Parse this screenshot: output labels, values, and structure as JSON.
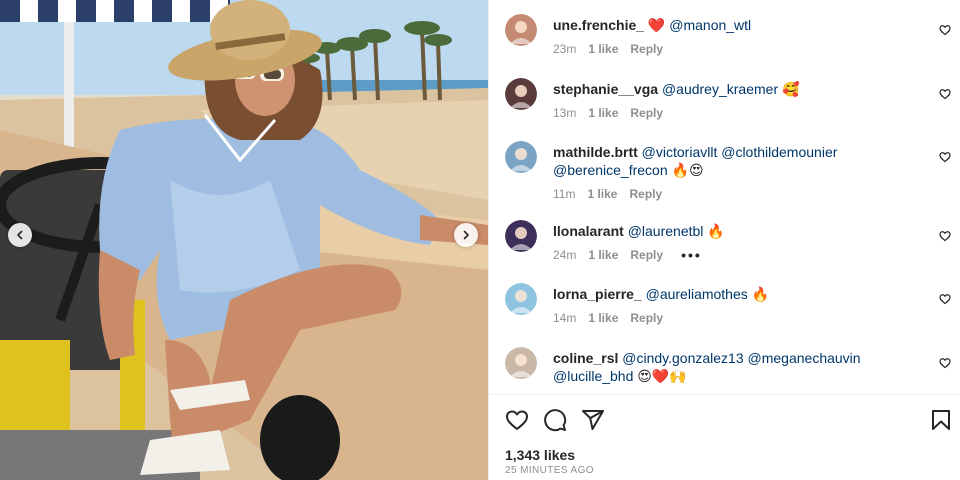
{
  "post": {
    "image_icon": "beach-photo",
    "nav": {
      "prev_icon": "chevron-left-icon",
      "next_icon": "chevron-right-icon"
    }
  },
  "comments": [
    {
      "username": "une.frenchie_",
      "text_parts": [
        {
          "t": "❤️ ",
          "m": false
        },
        {
          "t": "@manon_wtl",
          "m": true
        }
      ],
      "time": "23m",
      "likes": "1 like",
      "reply": "Reply",
      "avatar_color": "#c48a73"
    },
    {
      "username": "stephanie__vga",
      "text_parts": [
        {
          "t": "@audrey_kraemer",
          "m": true
        },
        {
          "t": " 🥰",
          "m": false
        }
      ],
      "time": "13m",
      "likes": "1 like",
      "reply": "Reply",
      "avatar_color": "#5a3a3a"
    },
    {
      "username": "mathilde.brtt",
      "text_parts": [
        {
          "t": "@victoriavllt",
          "m": true
        },
        {
          "t": " ",
          "m": false
        },
        {
          "t": "@clothildemounier",
          "m": true
        },
        {
          "t": " ",
          "m": false
        },
        {
          "t": "@berenice_frecon",
          "m": true
        },
        {
          "t": " 🔥😍",
          "m": false
        }
      ],
      "time": "11m",
      "likes": "1 like",
      "reply": "Reply",
      "avatar_color": "#7ba3c4"
    },
    {
      "username": "llonalarant",
      "text_parts": [
        {
          "t": "@laurenetbl",
          "m": true
        },
        {
          "t": " 🔥",
          "m": false
        }
      ],
      "time": "24m",
      "likes": "1 like",
      "reply": "Reply",
      "more": "•••",
      "avatar_color": "#3d2f5a"
    },
    {
      "username": "lorna_pierre_",
      "text_parts": [
        {
          "t": "@aureliamothes",
          "m": true
        },
        {
          "t": " 🔥",
          "m": false
        }
      ],
      "time": "14m",
      "likes": "1 like",
      "reply": "Reply",
      "avatar_color": "#8fc4e0"
    },
    {
      "username": "coline_rsl",
      "text_parts": [
        {
          "t": "@cindy.gonzalez13",
          "m": true
        },
        {
          "t": " ",
          "m": false
        },
        {
          "t": "@meganechauvin",
          "m": true
        },
        {
          "t": " ",
          "m": false
        },
        {
          "t": "@lucille_bhd",
          "m": true
        },
        {
          "t": " 😍❤️🙌",
          "m": false
        }
      ],
      "time": "",
      "likes": "",
      "reply": "",
      "avatar_color": "#c9b8a8"
    }
  ],
  "actions": {
    "like_icon": "heart-icon",
    "comment_icon": "comment-icon",
    "share_icon": "share-icon",
    "save_icon": "bookmark-icon",
    "likes_count": "1,343 likes",
    "timestamp": "25 MINUTES AGO"
  }
}
